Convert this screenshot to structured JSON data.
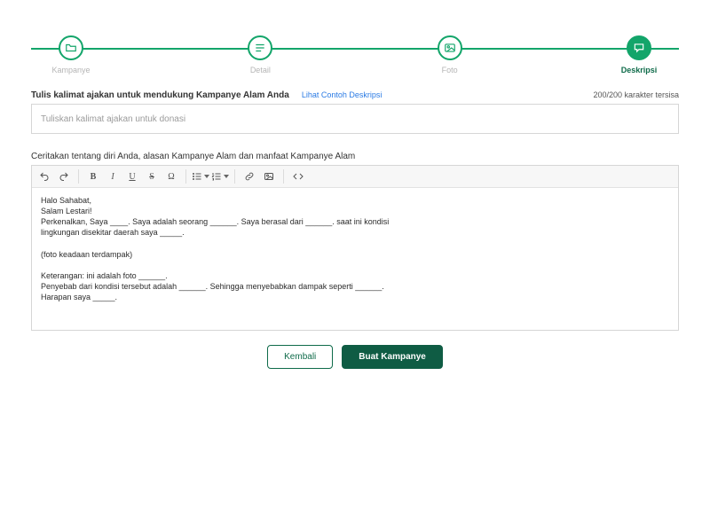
{
  "stepper": {
    "steps": [
      {
        "label": "Kampanye"
      },
      {
        "label": "Detail"
      },
      {
        "label": "Foto"
      },
      {
        "label": "Deskripsi"
      }
    ],
    "current_index": 3
  },
  "section1": {
    "label": "Tulis kalimat ajakan untuk mendukung Kampanye Alam Anda",
    "link_text": "Lihat Contoh Deskripsi",
    "char_left": "200/200 karakter tersisa",
    "placeholder": "Tuliskan kalimat ajakan untuk donasi"
  },
  "section2": {
    "label": "Ceritakan tentang diri Anda, alasan Kampanye Alam dan manfaat Kampanye Alam",
    "body": "Halo Sahabat,\nSalam Lestari!\nPerkenalkan, Saya ____. Saya adalah seorang ______. Saya berasal dari ______. saat ini kondisi\nlingkungan disekitar daerah saya _____.\n\n(foto keadaan terdampak)\n\nKeterangan: ini adalah foto ______.\nPenyebab dari kondisi tersebut adalah ______. Sehingga menyebabkan dampak seperti ______.\nHarapan saya _____."
  },
  "buttons": {
    "back": "Kembali",
    "submit": "Buat Kampanye"
  },
  "toolbar_icons": {
    "undo": "undo-icon",
    "redo": "redo-icon",
    "bold": "bold-icon",
    "italic": "italic-icon",
    "underline": "underline-icon",
    "strike": "strike-icon",
    "omega": "omega-icon",
    "list_ul": "list-ul-icon",
    "list_ol": "list-ol-icon",
    "link": "link-icon",
    "image": "image-icon",
    "code": "code-icon"
  }
}
